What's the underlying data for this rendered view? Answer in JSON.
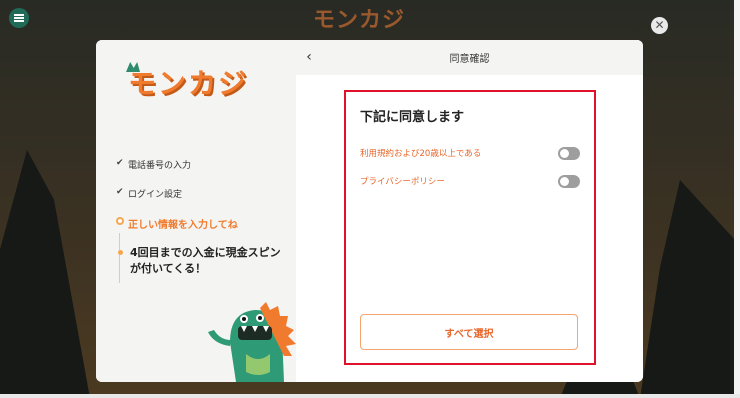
{
  "app": {
    "brand": "モンカジ"
  },
  "modal": {
    "header_title": "同意確認",
    "steps": [
      {
        "label": "電話番号の入力"
      },
      {
        "label": "ログイン設定"
      },
      {
        "label": "正しい情報を入力してね"
      },
      {
        "label": "4回目までの入金に現金スピンが付いてくる！"
      }
    ],
    "agree": {
      "title": "下記に同意します",
      "items": [
        {
          "label": "利用規約および20歳以上である",
          "checked": false
        },
        {
          "label": "プライバシーポリシー",
          "checked": false
        }
      ],
      "select_all_label": "すべて選択"
    }
  },
  "colors": {
    "accent": "#f07b2e",
    "highlight_border": "#e0112b",
    "mascot": "#2f9a76"
  }
}
